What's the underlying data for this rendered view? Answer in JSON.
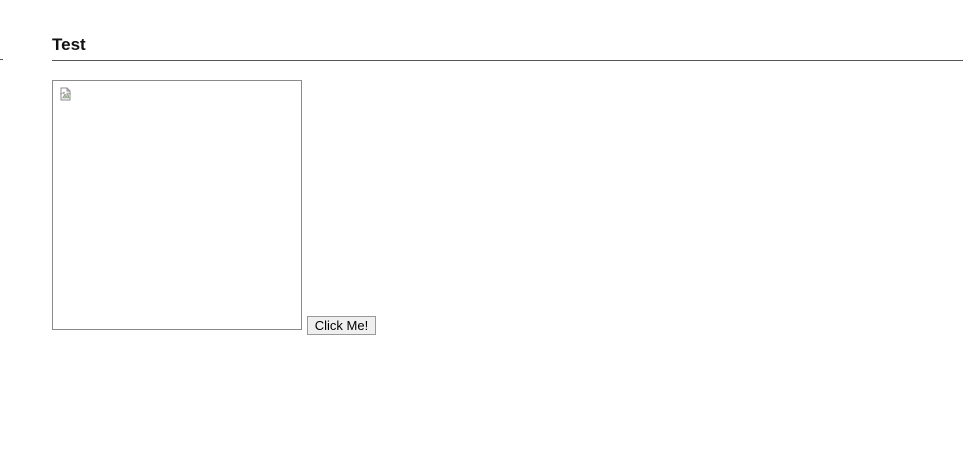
{
  "page": {
    "title": "Test"
  },
  "image": {
    "icon": "broken-image-icon"
  },
  "button": {
    "label": "Click Me!"
  },
  "colors": {
    "rule": "#555555",
    "frame_border": "#8a8a8a",
    "button_bg": "#efefef",
    "button_border": "#999999"
  }
}
